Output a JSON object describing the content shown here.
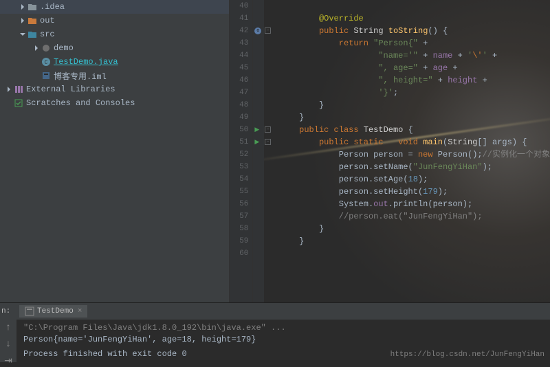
{
  "sidebar": {
    "items": [
      {
        "label": ".idea",
        "indent": 28,
        "icon": "folder-gray",
        "arrow": "right"
      },
      {
        "label": "out",
        "indent": 28,
        "icon": "folder-orange",
        "arrow": "right"
      },
      {
        "label": "src",
        "indent": 28,
        "icon": "folder-blue",
        "arrow": "down"
      },
      {
        "label": "demo",
        "indent": 48,
        "icon": "pkg",
        "arrow": "right"
      },
      {
        "label": "TestDemo.java",
        "indent": 48,
        "icon": "java",
        "highlight": true
      },
      {
        "label": "博客专用.iml",
        "indent": 48,
        "icon": "module"
      },
      {
        "label": "External Libraries",
        "indent": 8,
        "icon": "lib",
        "arrow": "right"
      },
      {
        "label": "Scratches and Consoles",
        "indent": 8,
        "icon": "scratch"
      }
    ]
  },
  "editor": {
    "startLine": 40,
    "lines": [
      [],
      [
        {
          "cls": "an",
          "t": "        @Override"
        }
      ],
      [
        {
          "cls": "",
          "t": "        "
        },
        {
          "cls": "kw",
          "t": "public "
        },
        {
          "cls": "ty",
          "t": "String "
        },
        {
          "cls": "mth",
          "t": "toString"
        },
        {
          "cls": "",
          "t": "() {"
        }
      ],
      [
        {
          "cls": "",
          "t": "            "
        },
        {
          "cls": "kw",
          "t": "return "
        },
        {
          "cls": "str",
          "t": "\"Person{\""
        },
        {
          "cls": "",
          "t": " +"
        }
      ],
      [
        {
          "cls": "",
          "t": "                    "
        },
        {
          "cls": "str",
          "t": "\"name='\""
        },
        {
          "cls": "",
          "t": " + "
        },
        {
          "cls": "field",
          "t": "name"
        },
        {
          "cls": "",
          "t": " + "
        },
        {
          "cls": "str",
          "t": "'"
        },
        {
          "cls": "esc",
          "t": "\\'"
        },
        {
          "cls": "str",
          "t": "'"
        },
        {
          "cls": "",
          "t": " +"
        }
      ],
      [
        {
          "cls": "",
          "t": "                    "
        },
        {
          "cls": "str",
          "t": "\", age=\""
        },
        {
          "cls": "",
          "t": " + "
        },
        {
          "cls": "field",
          "t": "age"
        },
        {
          "cls": "",
          "t": " +"
        }
      ],
      [
        {
          "cls": "",
          "t": "                    "
        },
        {
          "cls": "str",
          "t": "\", height=\""
        },
        {
          "cls": "",
          "t": " + "
        },
        {
          "cls": "field",
          "t": "height"
        },
        {
          "cls": "",
          "t": " +"
        }
      ],
      [
        {
          "cls": "",
          "t": "                    "
        },
        {
          "cls": "str",
          "t": "'}'"
        },
        {
          "cls": "",
          "t": ";"
        }
      ],
      [
        {
          "cls": "",
          "t": "        }"
        }
      ],
      [
        {
          "cls": "",
          "t": "    }"
        }
      ],
      [
        {
          "cls": "",
          "t": "    "
        },
        {
          "cls": "kw",
          "t": "public class "
        },
        {
          "cls": "ty",
          "t": "TestDemo"
        },
        {
          "cls": "",
          "t": " {"
        }
      ],
      [
        {
          "cls": "",
          "t": "        "
        },
        {
          "cls": "kw",
          "t": "public static   void "
        },
        {
          "cls": "mth",
          "t": "main"
        },
        {
          "cls": "",
          "t": "("
        },
        {
          "cls": "ty",
          "t": "String"
        },
        {
          "cls": "",
          "t": "[] "
        },
        {
          "cls": "param",
          "t": "args"
        },
        {
          "cls": "",
          "t": ") {"
        }
      ],
      [
        {
          "cls": "",
          "t": "            Person person = "
        },
        {
          "cls": "new",
          "t": "new "
        },
        {
          "cls": "",
          "t": "Person();"
        },
        {
          "cls": "cm",
          "t": "//实例化一个对象"
        }
      ],
      [
        {
          "cls": "",
          "t": "            person.setName("
        },
        {
          "cls": "str",
          "t": "\"JunFengYiHan\""
        },
        {
          "cls": "",
          "t": ");"
        }
      ],
      [
        {
          "cls": "",
          "t": "            person.setAge("
        },
        {
          "cls": "num",
          "t": "18"
        },
        {
          "cls": "",
          "t": ");"
        }
      ],
      [
        {
          "cls": "",
          "t": "            person.setHeight("
        },
        {
          "cls": "num",
          "t": "179"
        },
        {
          "cls": "",
          "t": ");"
        }
      ],
      [
        {
          "cls": "",
          "t": "            System."
        },
        {
          "cls": "field",
          "t": "out"
        },
        {
          "cls": "",
          "t": ".println(person);"
        }
      ],
      [
        {
          "cls": "",
          "t": "            "
        },
        {
          "cls": "cm",
          "t": "//person.eat(\"JunFengYiHan\");"
        }
      ],
      [
        {
          "cls": "",
          "t": "        }"
        }
      ],
      [
        {
          "cls": "",
          "t": "    }"
        }
      ],
      []
    ],
    "runMarkers": [
      50,
      51
    ],
    "overrideMarkers": [
      42
    ],
    "foldMarkers": [
      42,
      50,
      51
    ]
  },
  "console": {
    "tab_label": "TestDemo",
    "line1": "\"C:\\Program Files\\Java\\jdk1.8.0_192\\bin\\java.exe\" ...",
    "line2": "Person{name='JunFengYiHan', age=18, height=179}",
    "line3": "Process finished with exit code 0"
  },
  "watermark": "https://blog.csdn.net/JunFengYiHan"
}
